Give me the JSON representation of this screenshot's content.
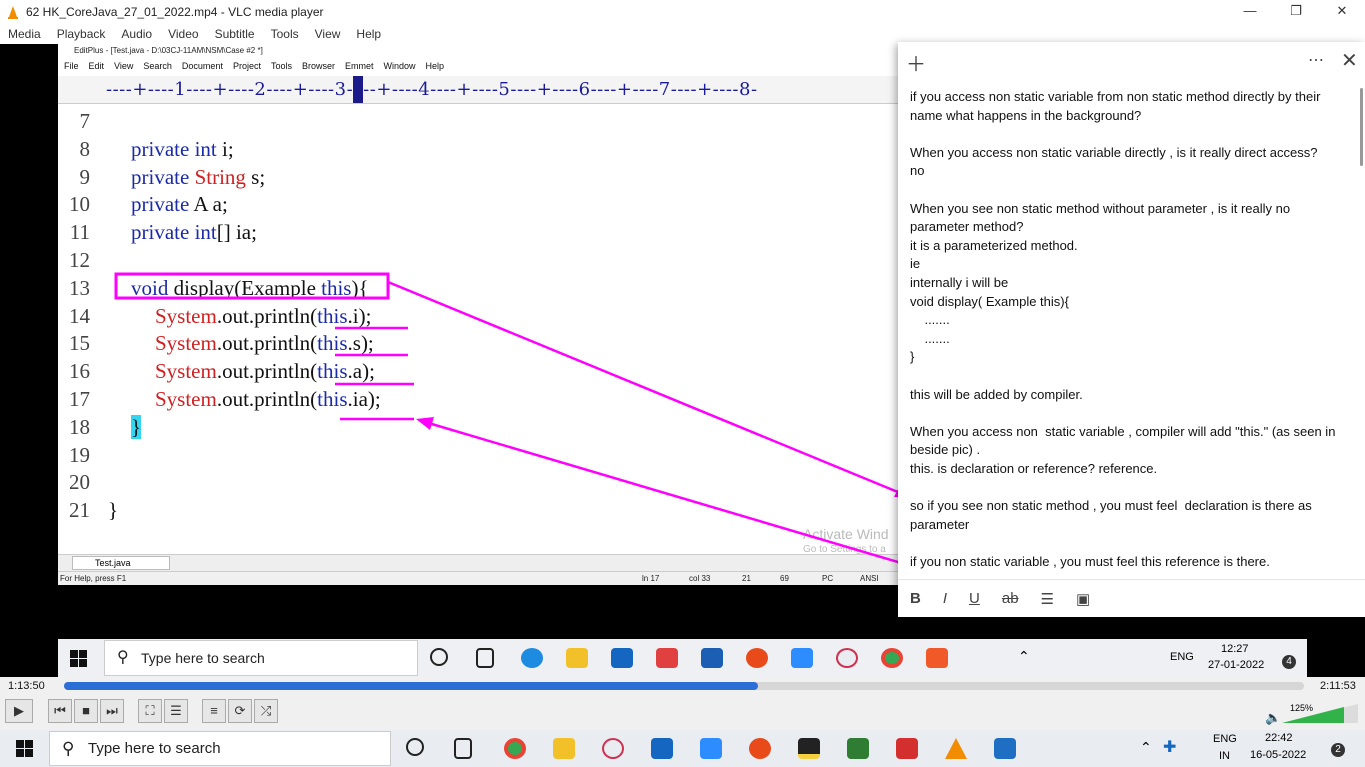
{
  "vlc": {
    "title": "62 HK_CoreJava_27_01_2022.mp4 - VLC media player",
    "menu": [
      "Media",
      "Playback",
      "Audio",
      "Video",
      "Subtitle",
      "Tools",
      "View",
      "Help"
    ],
    "time_elapsed": "1:13:50",
    "time_total": "2:11:53",
    "progress": 0.56,
    "volume": "125%"
  },
  "editplus": {
    "title": "EditPlus - [Test.java - D:\\03CJ-11AM\\NSM\\Case #2 *]",
    "menu": [
      "File",
      "Edit",
      "View",
      "Search",
      "Document",
      "Project",
      "Tools",
      "Browser",
      "Emmet",
      "Window",
      "Help"
    ],
    "ruler": "----+----1----+----2----+----3-",
    "ruler2": "--+----4----+----5----+----6----+----7----+----8-",
    "code_lines": [
      {
        "n": "7",
        "parts": []
      },
      {
        "n": "8",
        "parts": [
          {
            "t": "private ",
            "c": "kw"
          },
          {
            "t": "int",
            "c": "kw"
          },
          {
            "t": " i;",
            "c": ""
          }
        ]
      },
      {
        "n": "9",
        "parts": [
          {
            "t": "private ",
            "c": "kw"
          },
          {
            "t": "String",
            "c": "ty"
          },
          {
            "t": " s;",
            "c": ""
          }
        ]
      },
      {
        "n": "10",
        "parts": [
          {
            "t": "private ",
            "c": "kw"
          },
          {
            "t": "A a;",
            "c": ""
          }
        ]
      },
      {
        "n": "11",
        "parts": [
          {
            "t": "private ",
            "c": "kw"
          },
          {
            "t": "int",
            "c": "kw"
          },
          {
            "t": "[] ia;",
            "c": ""
          }
        ]
      },
      {
        "n": "12",
        "parts": []
      },
      {
        "n": "13",
        "parts": [
          {
            "t": "void",
            "c": "kw"
          },
          {
            "t": " display(Example ",
            "c": ""
          },
          {
            "t": "this",
            "c": "kw"
          },
          {
            "t": "){",
            "c": ""
          }
        ]
      },
      {
        "n": "14",
        "parts": [
          {
            "t": "System",
            "c": "ty"
          },
          {
            "t": ".out.println(",
            "c": ""
          },
          {
            "t": "this",
            "c": "kw"
          },
          {
            "t": ".i);",
            "c": ""
          }
        ]
      },
      {
        "n": "15",
        "parts": [
          {
            "t": "System",
            "c": "ty"
          },
          {
            "t": ".out.println(",
            "c": ""
          },
          {
            "t": "this",
            "c": "kw"
          },
          {
            "t": ".s);",
            "c": ""
          }
        ]
      },
      {
        "n": "16",
        "parts": [
          {
            "t": "System",
            "c": "ty"
          },
          {
            "t": ".out.println(",
            "c": ""
          },
          {
            "t": "this",
            "c": "kw"
          },
          {
            "t": ".a);",
            "c": ""
          }
        ]
      },
      {
        "n": "17",
        "parts": [
          {
            "t": "System",
            "c": "ty"
          },
          {
            "t": ".out.println(",
            "c": ""
          },
          {
            "t": "this",
            "c": "kw"
          },
          {
            "t": ".ia);",
            "c": ""
          }
        ]
      },
      {
        "n": "18",
        "parts": [
          {
            "t": "}",
            "c": ""
          }
        ]
      },
      {
        "n": "19",
        "parts": []
      },
      {
        "n": "20",
        "parts": []
      },
      {
        "n": "21",
        "parts": [
          {
            "t": "}",
            "c": ""
          }
        ]
      }
    ],
    "tab": "Test.java",
    "status": {
      "help": "For Help, press F1",
      "ln": "ln 17",
      "col": "col 33",
      "v1": "21",
      "v2": "69",
      "mode": "PC",
      "enc": "ANSI"
    },
    "watermark1": "Activate Wind",
    "watermark2": "Go to Settings to a"
  },
  "inner_taskbar": {
    "search": "Type here to search",
    "time": "12:27",
    "date": "27-01-2022",
    "lang": "ENG",
    "badge": "4"
  },
  "note": {
    "lines": [
      "if you access non static variable from non static method directly by their name what happens in the background?",
      "",
      "When you access non static variable directly , is it really direct access?",
      "no",
      "",
      "When you see non static method without parameter , is it really no parameter method?",
      "it is a parameterized method.",
      "ie",
      "internally i will be",
      "void display( Example this){",
      "    .......",
      "    .......",
      "}",
      "",
      "this will be added by compiler.",
      "",
      "When you access non  static variable , compiler will add \"this.\" (as seen in beside pic) .",
      "this. is declaration or reference? reference.",
      "",
      "so if you see non static method , you must feel  declaration is there as parameter",
      "",
      "if you non static variable , you must feel this reference is there."
    ],
    "toolbar": [
      "B",
      "I",
      "U",
      "ab",
      "list",
      "image"
    ]
  },
  "taskbar": {
    "search": "Type here to search",
    "lang1": "ENG",
    "lang2": "IN",
    "time": "22:42",
    "date": "16-05-2022",
    "badge": "2"
  },
  "colors": {
    "annotation": "#ff00ff",
    "keyword": "#1a2aa8",
    "type": "#d02020",
    "vlc_progress": "#2b6fd6"
  }
}
